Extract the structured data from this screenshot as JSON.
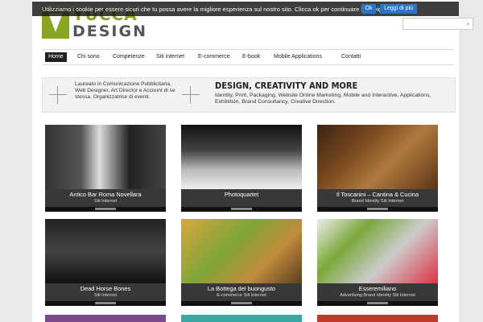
{
  "logo": {
    "word1": "YUCCA",
    "word2": "DESIGN"
  },
  "cookie": {
    "message": "Utilizziamo i cookie per essere sicuri che tu possa avere la migliore esperienza sul nostro sito. Clicca ok per continuare la navigazione.",
    "ok_label": "Ok",
    "more_label": "Leggi di più"
  },
  "search": {
    "icon": "search-icon",
    "glyph": "⌕"
  },
  "nav": {
    "items": [
      "Home",
      "Chi sono",
      "Competenze",
      "Siti internet",
      "E-commerce",
      "E-book",
      "Mobile Applications",
      "Contatti"
    ]
  },
  "hero": {
    "intro": "Laureato in Comunicazione Pubblicitaria, Web Designer, Art Director e Account di se stessa. Organizzatrice di eventi.",
    "title": "DESIGN, CREATIVITY AND MORE",
    "description": "Identity, Print, Packaging, Website Online Marketing, Mobile and Interactive, Applications, Exhibition, Brand Consultancy, Creative Direction."
  },
  "portfolio": [
    {
      "title": "Antico Bar Roma Novellara",
      "tags": "Siti Internet"
    },
    {
      "title": "Photoquartet",
      "tags": ""
    },
    {
      "title": "Il Toscanini – Cantina & Cucina",
      "tags": "Brand Identity   Siti Internet"
    },
    {
      "title": "Dead Horse Bones",
      "tags": "Siti Internet"
    },
    {
      "title": "La Bottega del buongusto",
      "tags": "E-commerce   Siti Internet"
    },
    {
      "title": "Esseremiliano",
      "tags": "Advertising   Brand Identity   Siti Internet"
    }
  ],
  "colors": {
    "brand": "#8aa520",
    "button": "#2a74c9",
    "nav_active": "#222222"
  }
}
